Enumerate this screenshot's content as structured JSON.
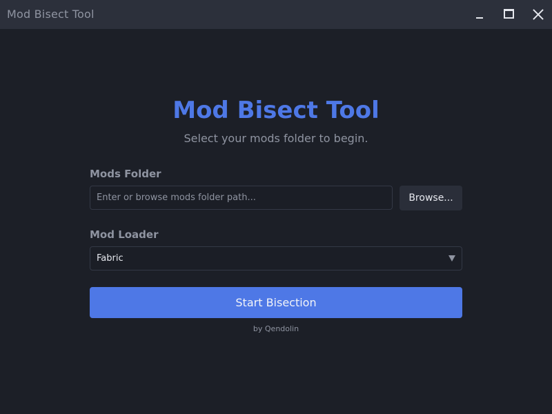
{
  "window": {
    "title": "Mod Bisect Tool"
  },
  "main": {
    "heading": "Mod Bisect Tool",
    "subtitle": "Select your mods folder to begin.",
    "mods_folder": {
      "label": "Mods Folder",
      "value": "",
      "placeholder": "Enter or browse mods folder path...",
      "browse_label": "Browse..."
    },
    "mod_loader": {
      "label": "Mod Loader",
      "selected": "Fabric"
    },
    "start_label": "Start Bisection",
    "credit": "by Qendolin"
  },
  "icons": {
    "minimize": "minimize-icon",
    "maximize": "maximize-icon",
    "close": "close-icon",
    "dropdown": "chevron-down-icon"
  },
  "colors": {
    "accent": "#4e78e6",
    "background": "#1c1f27",
    "titlebar": "#2c303b",
    "muted_text": "#8f94a1"
  }
}
